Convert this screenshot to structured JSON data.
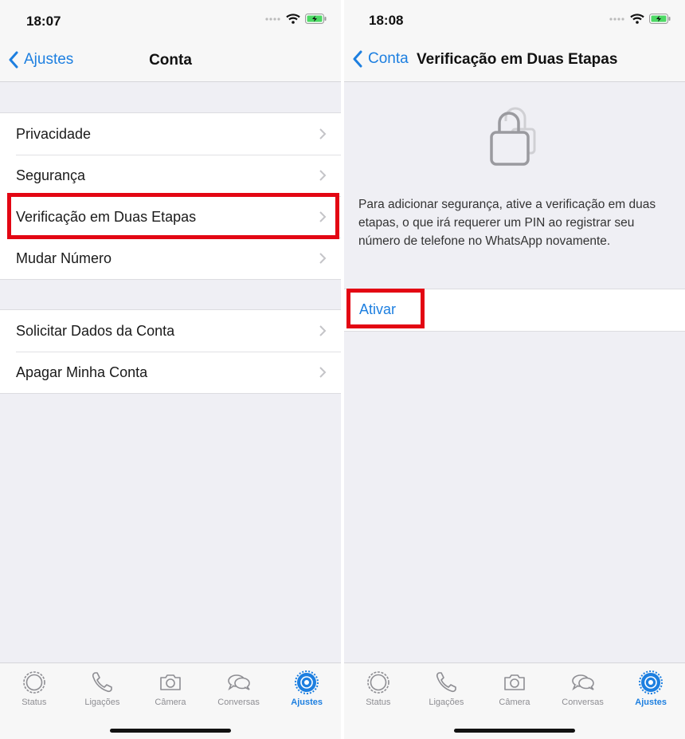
{
  "screen1": {
    "status": {
      "time": "18:07"
    },
    "nav": {
      "back_label": "Ajustes",
      "title": "Conta"
    },
    "group1": [
      "Privacidade",
      "Segurança",
      "Verificação em Duas Etapas",
      "Mudar Número"
    ],
    "group2": [
      "Solicitar Dados da Conta",
      "Apagar Minha Conta"
    ]
  },
  "screen2": {
    "status": {
      "time": "18:08"
    },
    "nav": {
      "back_label": "Conta",
      "title": "Verificação em Duas Etapas"
    },
    "description": "Para adicionar segurança, ative a verificação em duas etapas, o que irá requerer um PIN ao registrar seu número de telefone no WhatsApp novamente.",
    "action": "Ativar"
  },
  "tabs": [
    "Status",
    "Ligações",
    "Câmera",
    "Conversas",
    "Ajustes"
  ],
  "active_tab": "Ajustes",
  "colors": {
    "accent": "#1d7fe0",
    "highlight": "#e30613",
    "battery": "#4cd964"
  },
  "icons": [
    "status-icon",
    "phone-icon",
    "camera-icon",
    "chat-icon",
    "gear-icon",
    "lock-icon",
    "chevron-right-icon",
    "wifi-icon",
    "battery-icon"
  ]
}
